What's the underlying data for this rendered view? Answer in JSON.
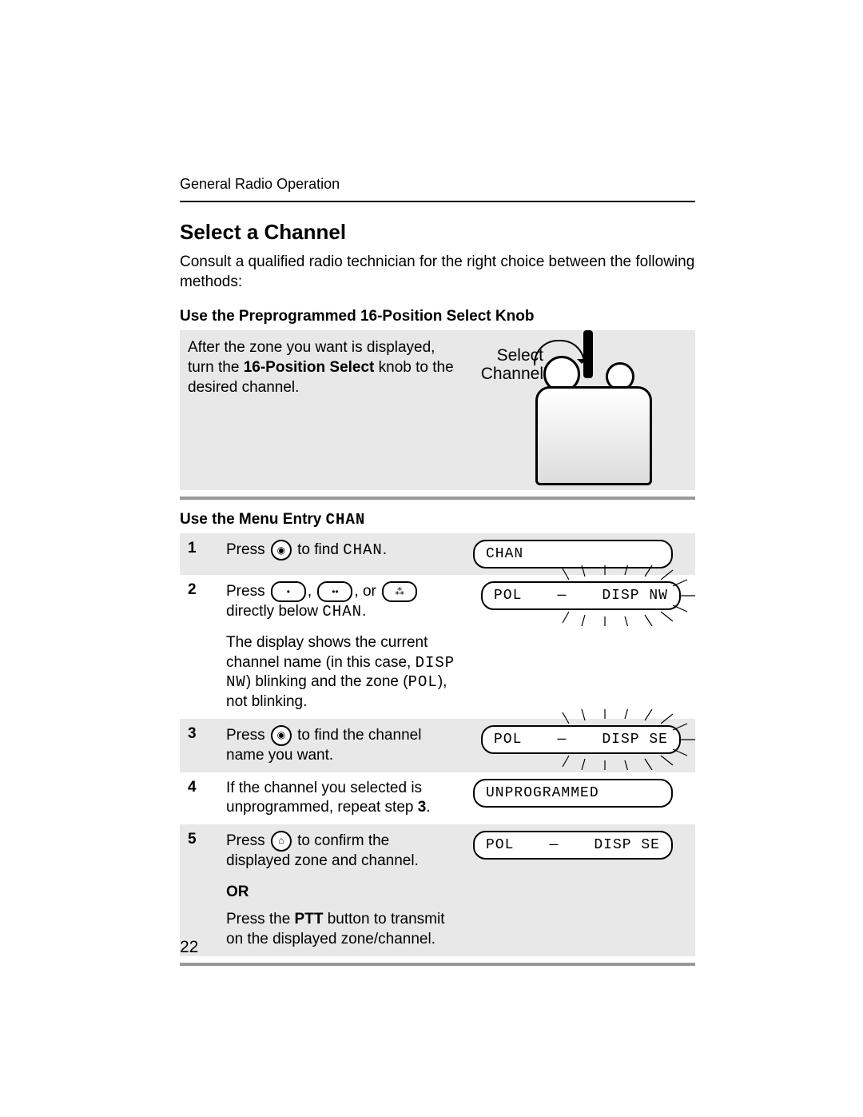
{
  "header": {
    "running": "General Radio Operation"
  },
  "title": "Select a Channel",
  "intro": "Consult a qualified radio technician for the right choice between the following methods:",
  "sectionA": {
    "heading": "Use the Preprogrammed 16-Position Select Knob",
    "text_pre": "After the zone you want is displayed, turn the ",
    "text_bold": "16-Position Select",
    "text_post": " knob to the desired channel.",
    "label_line1": "Select",
    "label_line2": "Channel"
  },
  "sectionB": {
    "heading_pre": "Use the Menu Entry ",
    "heading_code": "CHAN"
  },
  "steps": [
    {
      "num": "1",
      "parts": [
        "Press ",
        "ICON_NAV",
        " to find ",
        "CODE:CHAN",
        "."
      ],
      "displays": [
        {
          "type": "plain",
          "left": "CHAN",
          "right": ""
        }
      ]
    },
    {
      "num": "2",
      "parts": [
        "Press ",
        "ICON_DOT1",
        ", ",
        "ICON_DOT2",
        ", or ",
        "ICON_DOT3",
        " directly below ",
        "CODE:CHAN",
        "."
      ],
      "extra": [
        "The display shows the current channel name (in this case, ",
        "CODE:DISP NW",
        ") blinking and the zone (",
        "CODE:POL",
        "), not blinking."
      ],
      "displays": [
        {
          "type": "burst",
          "left": "POL",
          "right": "DISP NW"
        }
      ]
    },
    {
      "num": "3",
      "parts": [
        "Press ",
        "ICON_NAV",
        " to find the channel name you want."
      ],
      "displays": [
        {
          "type": "burst",
          "left": "POL",
          "right": "DISP SE"
        }
      ]
    },
    {
      "num": "4",
      "parts": [
        "If the channel you selected is unprogrammed, repeat step ",
        "BOLD:3",
        "."
      ],
      "displays": [
        {
          "type": "plain",
          "left": "UNPROGRAMMED",
          "right": ""
        }
      ]
    },
    {
      "num": "5",
      "parts": [
        "Press ",
        "ICON_HOME",
        " to confirm the displayed zone and channel."
      ],
      "or": "OR",
      "extra2": [
        "Press the ",
        "BOLD:PTT",
        " button to transmit on the displayed zone/channel."
      ],
      "displays": [
        {
          "type": "plain",
          "left": "POL",
          "right": "DISP SE"
        }
      ]
    }
  ],
  "page_number": "22"
}
